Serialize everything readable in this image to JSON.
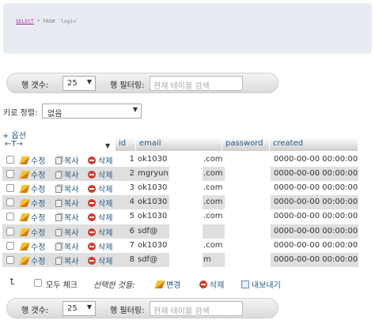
{
  "sql": {
    "keyword": "SELECT",
    "rest": "* FROM `login`"
  },
  "pager": {
    "rows_label": "행 갯수:",
    "rows_value": "25",
    "filter_label": "행 필터링:",
    "filter_placeholder": "현재 테이블 검색"
  },
  "sort": {
    "label": "키로 정렬:",
    "value": "없음"
  },
  "options_label": "+ 옵션",
  "arrows_label": "←T→",
  "columns": {
    "id": "id",
    "email": "email",
    "password": "password",
    "created": "created"
  },
  "actions": {
    "edit": "수정",
    "copy": "복사",
    "delete": "삭제"
  },
  "rows": [
    {
      "id": "1",
      "email_start": "ok1030",
      "email_end": ".com",
      "created": "0000-00-00 00:00:00"
    },
    {
      "id": "2",
      "email_start": "mgryun",
      "email_end": ".com",
      "created": "0000-00-00 00:00:00"
    },
    {
      "id": "3",
      "email_start": "ok1030",
      "email_end": ".com",
      "created": "0000-00-00 00:00:00"
    },
    {
      "id": "4",
      "email_start": "ok1030",
      "email_end": ".com",
      "created": "0000-00-00 00:00:00"
    },
    {
      "id": "5",
      "email_start": "ok1030",
      "email_end": ".com",
      "created": "0000-00-00 00:00:00"
    },
    {
      "id": "6",
      "email_start": "sdf@",
      "email_end": "",
      "created": "0000-00-00 00:00:00"
    },
    {
      "id": "7",
      "email_start": "ok1030",
      "email_end": ".com",
      "created": "0000-00-00 00:00:00"
    },
    {
      "id": "8",
      "email_start": "sdf@",
      "email_end": "m",
      "created": "0000-00-00 00:00:00"
    }
  ],
  "footer": {
    "check_all": "모두 체크",
    "with_selected": "선택한 것들:",
    "edit": "변경",
    "delete": "삭제",
    "export": "내보내기"
  }
}
